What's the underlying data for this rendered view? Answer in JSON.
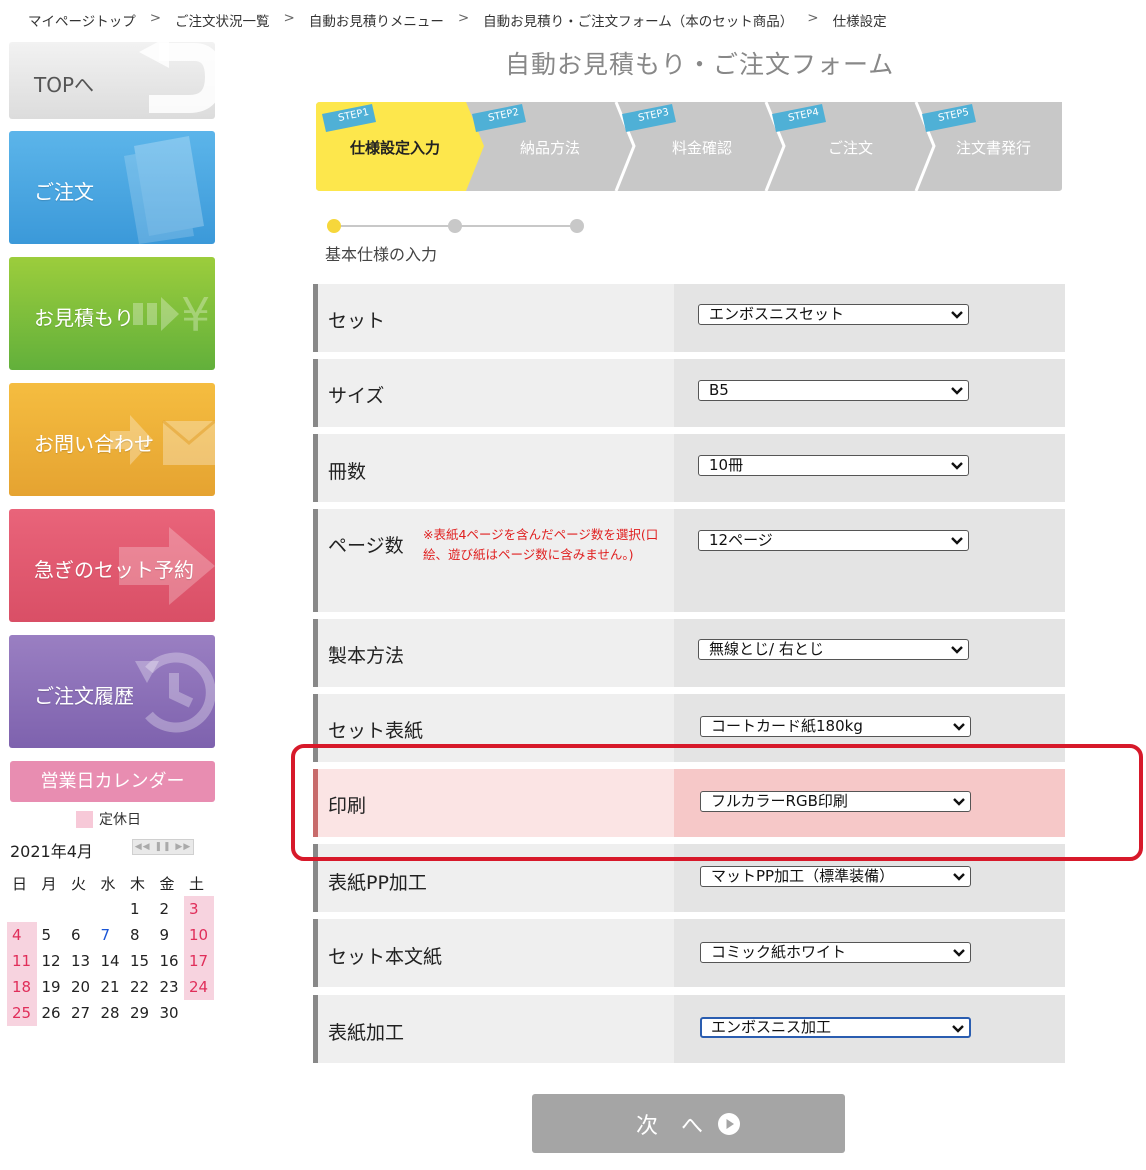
{
  "breadcrumb": [
    "マイページトップ",
    "ご注文状況一覧",
    "自動お見積りメニュー",
    "自動お見積り・ご注文フォーム（本のセット商品）",
    "仕様設定"
  ],
  "breadcrumb_separator": ">",
  "sidebar": {
    "top": "TOPへ",
    "order": "ご注文",
    "quote": "お見積もり",
    "contact": "お問い合わせ",
    "rush": "急ぎのセット予約",
    "history": "ご注文履歴"
  },
  "calendar": {
    "title": "営業日カレンダー",
    "legend": "定休日",
    "month": "2021年4月",
    "weekdays": [
      "日",
      "月",
      "火",
      "水",
      "木",
      "金",
      "土"
    ],
    "weeks": [
      [
        "",
        "",
        "",
        "",
        "1",
        "2",
        "3"
      ],
      [
        "4",
        "5",
        "6",
        "7",
        "8",
        "9",
        "10"
      ],
      [
        "11",
        "12",
        "13",
        "14",
        "15",
        "16",
        "17"
      ],
      [
        "18",
        "19",
        "20",
        "21",
        "22",
        "23",
        "24"
      ],
      [
        "25",
        "26",
        "27",
        "28",
        "29",
        "30",
        ""
      ]
    ],
    "holiday_color": "#f7d3df",
    "today": "7"
  },
  "form": {
    "title": "自動お見積もり・ご注文フォーム",
    "steps": [
      {
        "tag": "STEP1",
        "label": "仕様設定入力",
        "active": true
      },
      {
        "tag": "STEP2",
        "label": "納品方法",
        "active": false
      },
      {
        "tag": "STEP3",
        "label": "料金確認",
        "active": false
      },
      {
        "tag": "STEP4",
        "label": "ご注文",
        "active": false
      },
      {
        "tag": "STEP5",
        "label": "注文書発行",
        "active": false
      }
    ],
    "progress_label": "基本仕様の入力",
    "rows": [
      {
        "label": "セット",
        "value": "エンボスニスセット"
      },
      {
        "label": "サイズ",
        "value": "B5"
      },
      {
        "label": "冊数",
        "value": "10冊"
      },
      {
        "label": "ページ数",
        "value": "12ページ",
        "note": "※表紙4ページを含んだページ数を選択(口絵、遊び紙はページ数に含みません。)"
      },
      {
        "label": "製本方法",
        "value": "無線とじ/ 右とじ"
      },
      {
        "label": "セット表紙",
        "value": "コートカード紙180kg"
      },
      {
        "label": "印刷",
        "value": "フルカラーRGB印刷",
        "highlight": true
      },
      {
        "label": "表紙PP加工",
        "value": "マットPP加工（標準装備）"
      },
      {
        "label": "セット本文紙",
        "value": "コミック紙ホワイト"
      },
      {
        "label": "表紙加工",
        "value": "エンボスニス加工",
        "focused": true
      }
    ],
    "next_button": "次 へ"
  },
  "colors": {
    "active_step": "#fde74c",
    "inactive_step": "#c8c8c8",
    "step_tag": "#4fb0d6",
    "highlight_frame": "#d7192a"
  }
}
